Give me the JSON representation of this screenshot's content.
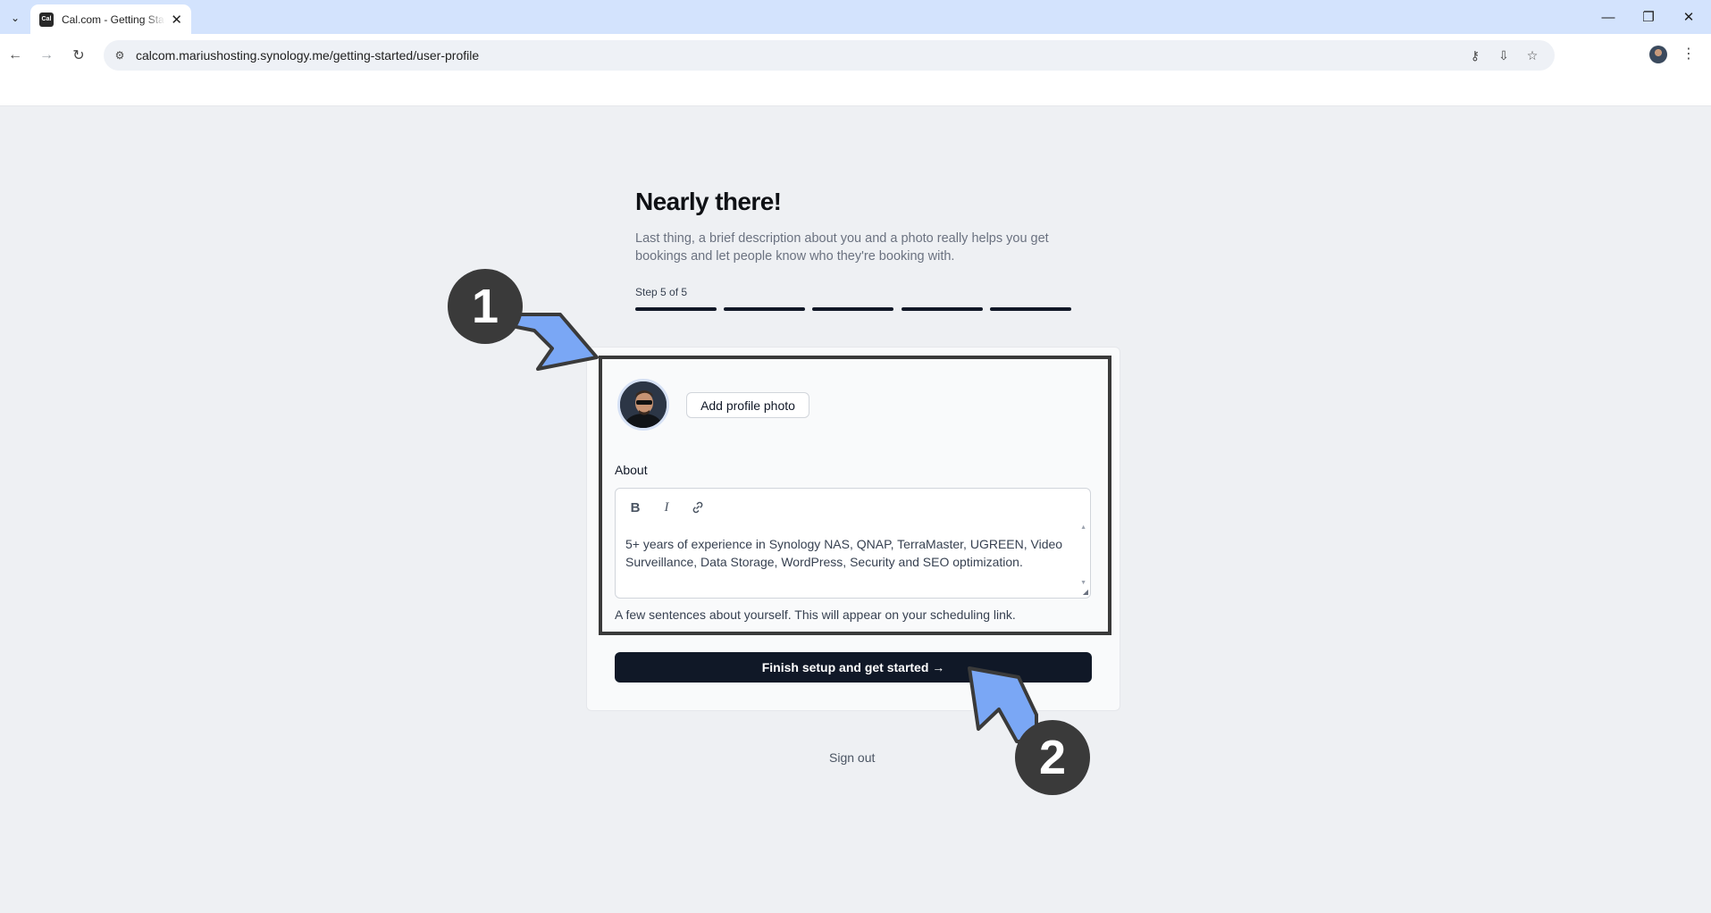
{
  "browser": {
    "tab_title": "Cal.com - Getting Started",
    "favicon_text": "Cal",
    "url": "calcom.mariushosting.synology.me/getting-started/user-profile"
  },
  "page": {
    "heading": "Nearly there!",
    "subtext": "Last thing, a brief description about you and a photo really helps you get bookings and let people know who they're booking with.",
    "step_label": "Step 5 of 5",
    "steps_total": 5,
    "steps_completed": 5
  },
  "profile": {
    "add_photo_label": "Add profile photo",
    "about_label": "About",
    "about_text": "5+ years of experience in Synology NAS, QNAP, TerraMaster, UGREEN, Video Surveillance, Data Storage, WordPress, Security and SEO optimization.",
    "helper_text": "A few sentences about yourself. This will appear on your scheduling link."
  },
  "editor_toolbar": {
    "bold": "B",
    "italic": "I"
  },
  "actions": {
    "finish_label": "Finish setup and get started →",
    "signout_label": "Sign out"
  },
  "annotations": {
    "badge_1": "1",
    "badge_2": "2",
    "arrow_color": "#7aa7f5",
    "badge_color": "#3a3a3a"
  }
}
